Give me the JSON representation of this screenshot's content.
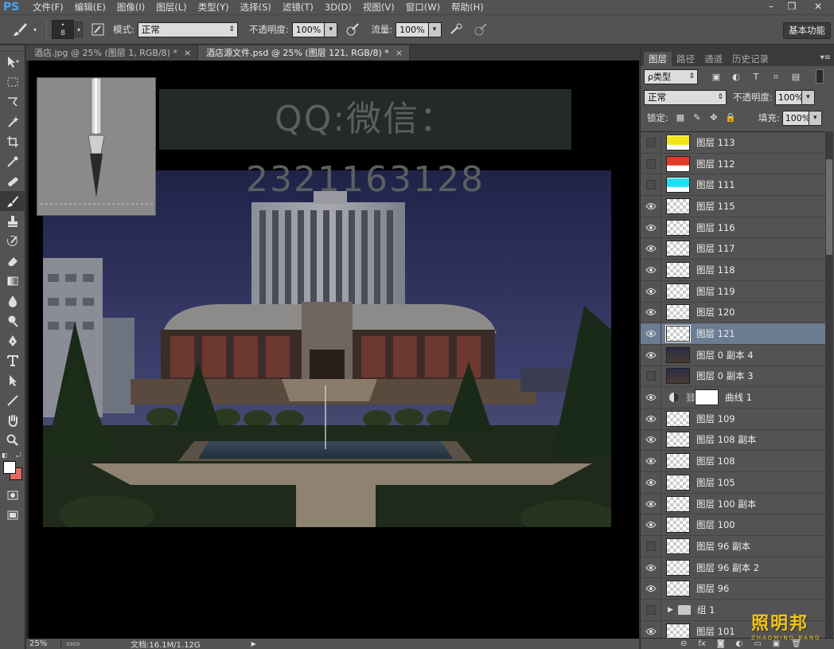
{
  "app": {
    "logo": "PS"
  },
  "menu": [
    "文件(F)",
    "编辑(E)",
    "图像(I)",
    "图层(L)",
    "类型(Y)",
    "选择(S)",
    "滤镜(T)",
    "3D(D)",
    "视图(V)",
    "窗口(W)",
    "帮助(H)"
  ],
  "window_controls": {
    "minimize": "–",
    "maximize": "❐",
    "close": "✕"
  },
  "options": {
    "brush_size": "8",
    "mode_label": "模式:",
    "mode_value": "正常",
    "opacity_label": "不透明度:",
    "opacity_value": "100%",
    "flow_label": "流量:",
    "flow_value": "100%",
    "workspace": "基本功能"
  },
  "doc_tabs": [
    {
      "label": "酒店.jpg @ 25% (图层 1, RGB/8) *",
      "close": "×"
    },
    {
      "label": "酒店源文件.psd @ 25% (图层 121, RGB/8) *",
      "close": "×"
    }
  ],
  "canvas": {
    "banner_text": "QQ:微信：2321163128"
  },
  "status": {
    "zoom": "25%",
    "doc": "文档:16.1M/1.12G",
    "arrow": "▶"
  },
  "panel": {
    "tabs": [
      "图层",
      "路径",
      "通道",
      "历史记录"
    ],
    "menu_icon": "▾≡",
    "filter_kind": "ρ类型",
    "filter_icons": [
      "▣",
      "◐",
      "T",
      "⌗",
      "▤"
    ],
    "blend_mode": "正常",
    "opacity_label": "不透明度:",
    "opacity_value": "100%",
    "lock_label": "锁定:",
    "lock_icons": [
      "▦",
      "✎",
      "✥",
      "🔒"
    ],
    "fill_label": "填充:",
    "fill_value": "100%",
    "bottom_icons": [
      "⊖",
      "fx",
      "◙",
      "◐",
      "▭",
      "▣",
      "🗑"
    ]
  },
  "layers": [
    {
      "name": "图层 113",
      "visible": false,
      "thumb": "yellow"
    },
    {
      "name": "图层 112",
      "visible": false,
      "thumb": "red"
    },
    {
      "name": "图层 111",
      "visible": false,
      "thumb": "cyan"
    },
    {
      "name": "图层 115",
      "visible": true,
      "thumb": "checker"
    },
    {
      "name": "图层 116",
      "visible": true,
      "thumb": "checker"
    },
    {
      "name": "图层 117",
      "visible": true,
      "thumb": "checker"
    },
    {
      "name": "图层 118",
      "visible": true,
      "thumb": "checker"
    },
    {
      "name": "图层 119",
      "visible": true,
      "thumb": "checker"
    },
    {
      "name": "图层 120",
      "visible": true,
      "thumb": "checker"
    },
    {
      "name": "图层 121",
      "visible": true,
      "thumb": "checker",
      "selected": true
    },
    {
      "name": "图层 0 副本 4",
      "visible": true,
      "thumb": "photo"
    },
    {
      "name": "图层 0 副本 3",
      "visible": false,
      "thumb": "photo"
    },
    {
      "name": "曲线 1",
      "visible": true,
      "thumb": "adjust"
    },
    {
      "name": "图层 109",
      "visible": true,
      "thumb": "checker"
    },
    {
      "name": "图层 108 副本",
      "visible": true,
      "thumb": "checker"
    },
    {
      "name": "图层 108",
      "visible": true,
      "thumb": "checker"
    },
    {
      "name": "图层 105",
      "visible": true,
      "thumb": "checker"
    },
    {
      "name": "图层 100 副本",
      "visible": true,
      "thumb": "checker"
    },
    {
      "name": "图层 100",
      "visible": true,
      "thumb": "checker"
    },
    {
      "name": "图层 96 副本",
      "visible": false,
      "thumb": "checker"
    },
    {
      "name": "图层 96 副本 2",
      "visible": true,
      "thumb": "checker"
    },
    {
      "name": "图层 96",
      "visible": true,
      "thumb": "checker"
    },
    {
      "name": "组 1",
      "visible": false,
      "thumb": "group"
    },
    {
      "name": "图层 101",
      "visible": true,
      "thumb": "checker"
    }
  ],
  "watermark": {
    "big": "照明邦",
    "small": "ZHAOMING BANG"
  },
  "colors": {
    "accent": "#6b7c93",
    "fg": "#ffffff",
    "bg": "#e46a60"
  }
}
